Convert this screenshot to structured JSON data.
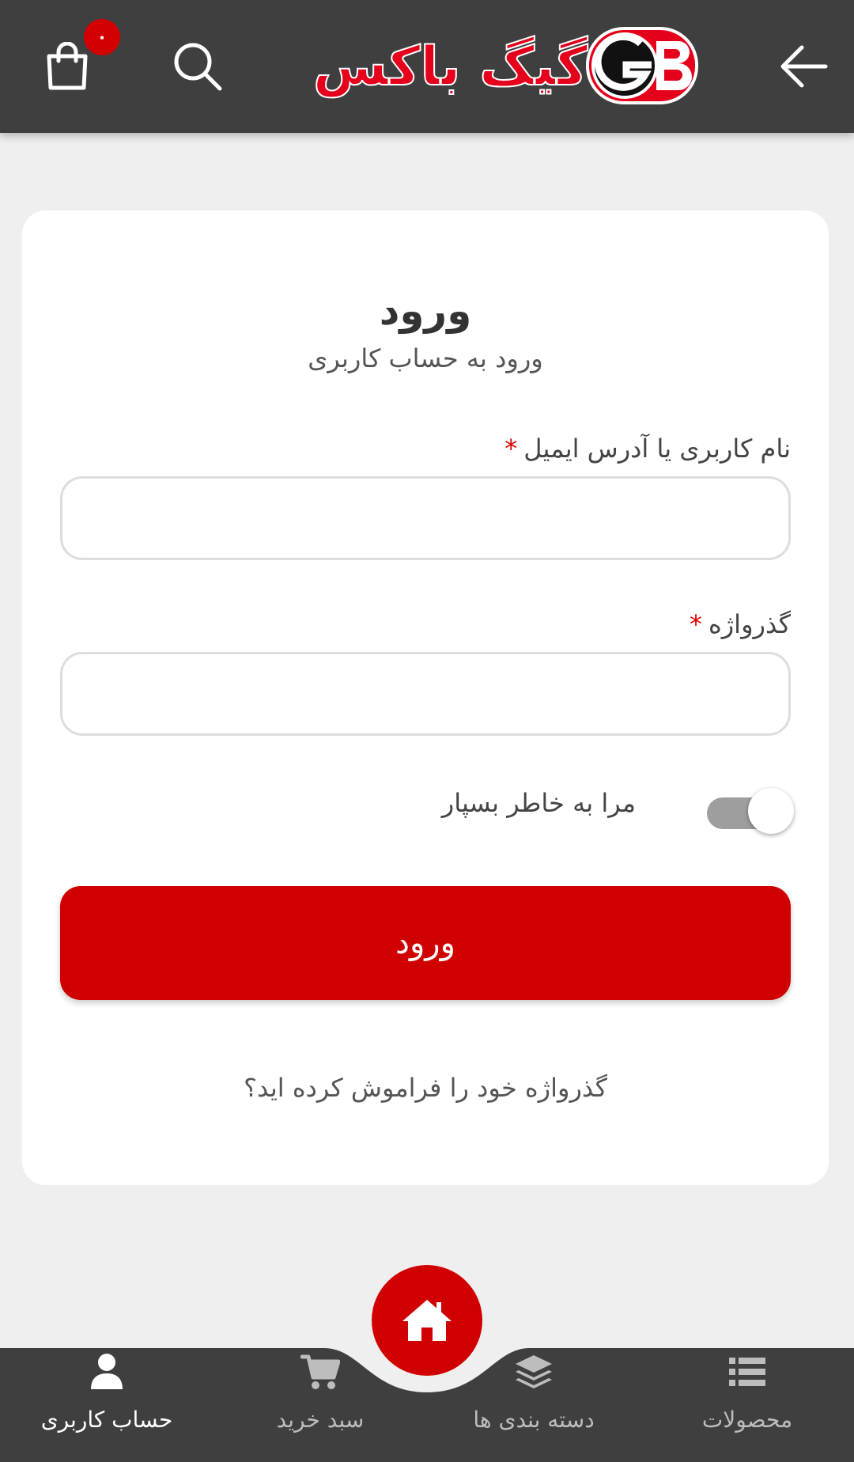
{
  "header": {
    "logo_text": "گیگ باکس",
    "logo_mark_text": "GB",
    "cart_count": "۰"
  },
  "login": {
    "title": "ورود",
    "subtitle": "ورود به حساب کاربری",
    "username_label": "نام کاربری یا آدرس ایمیل",
    "required_mark": "*",
    "username_value": "",
    "password_label": "گذرواژه",
    "password_value": "",
    "remember_label": "مرا به خاطر بسپار",
    "remember_enabled": true,
    "submit_label": "ورود",
    "forgot_link": "گذرواژه خود را فراموش کرده اید؟"
  },
  "bottom_nav": {
    "items": [
      {
        "label": "حساب کاربری",
        "icon": "user-icon",
        "active": true
      },
      {
        "label": "سبد خرید",
        "icon": "cart-icon",
        "active": false
      },
      {
        "label": "دسته بندی ها",
        "icon": "layers-icon",
        "active": false
      },
      {
        "label": "محصولات",
        "icon": "list-icon",
        "active": false
      }
    ],
    "home_icon": "home-icon"
  },
  "colors": {
    "header_bg": "#3f3f3f",
    "accent_red": "#d10000",
    "page_bg": "#efefef",
    "card_bg": "#ffffff",
    "nav_bg": "#3f3f3f"
  }
}
